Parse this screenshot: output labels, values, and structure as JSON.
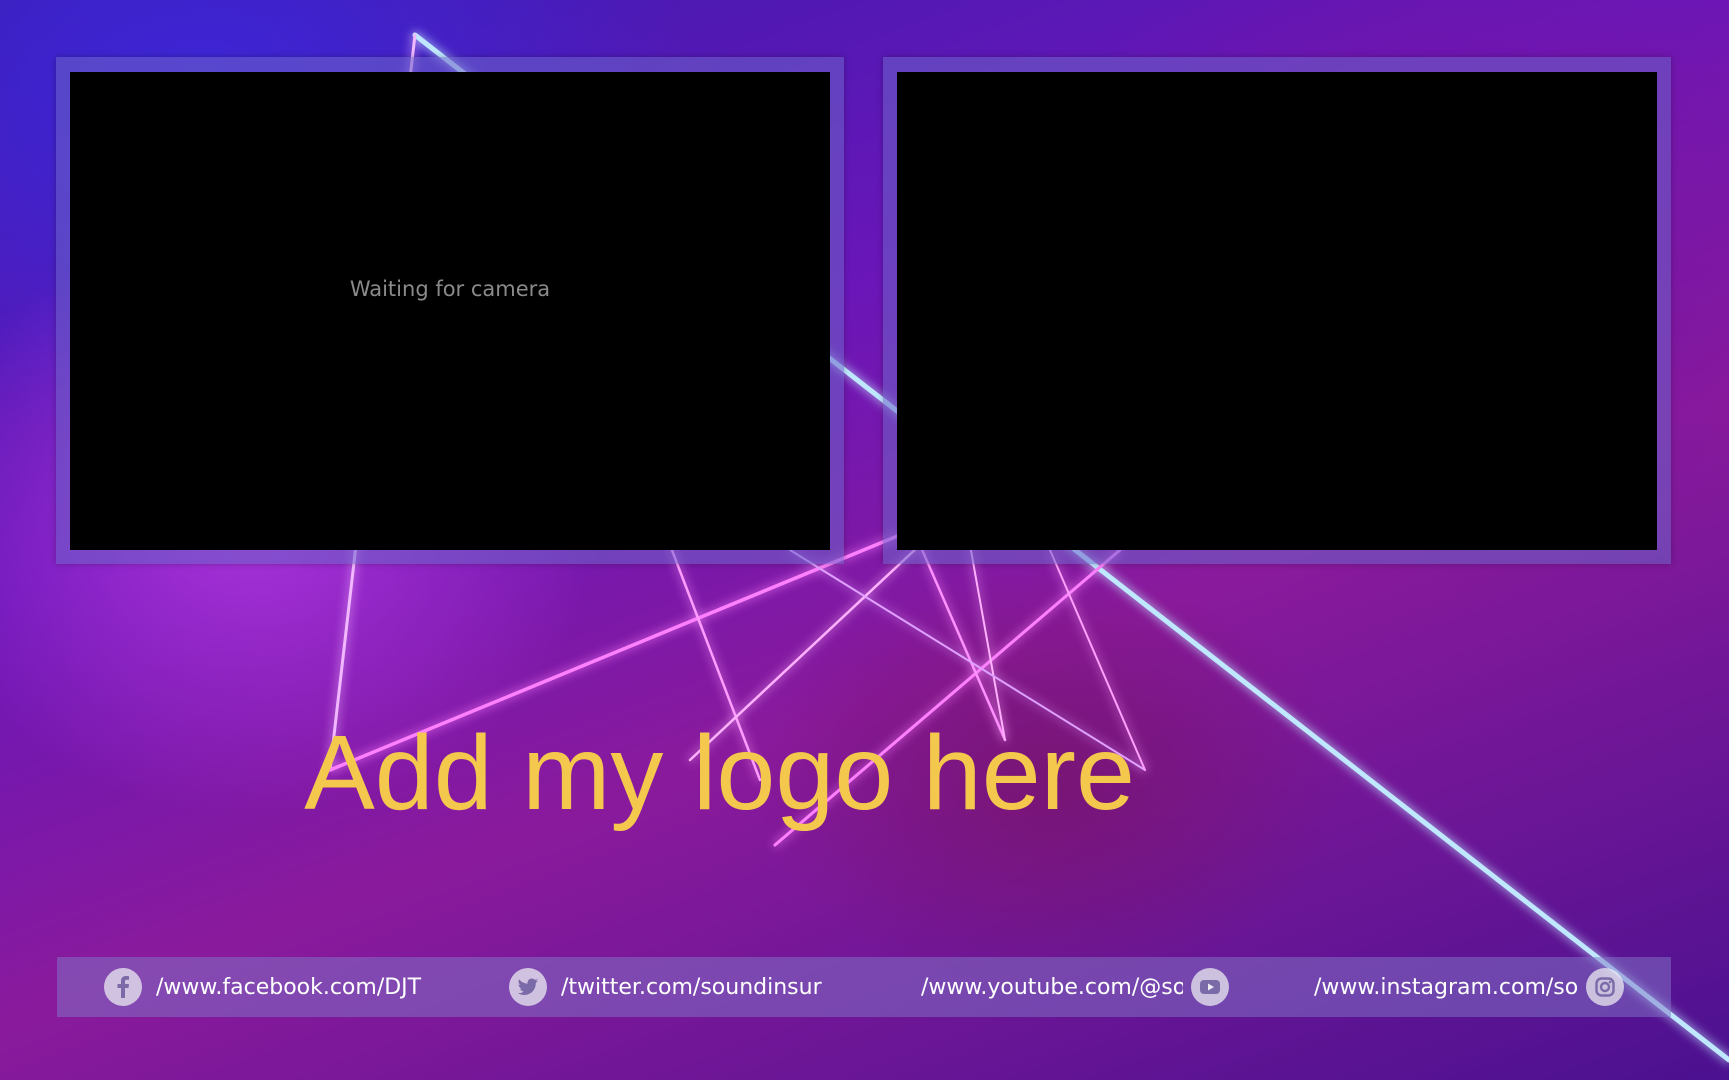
{
  "cameras": {
    "left_status": "Waiting for camera"
  },
  "logo": {
    "placeholder_text": "Add my logo here",
    "color": "#f4c84c"
  },
  "social": {
    "facebook": {
      "icon": "facebook-icon",
      "url": "/www.facebook.com/DJT"
    },
    "twitter": {
      "icon": "twitter-icon",
      "url": "/twitter.com/soundinsur"
    },
    "youtube": {
      "icon": "youtube-icon",
      "url": "/www.youtube.com/@so"
    },
    "instagram": {
      "icon": "instagram-icon",
      "url": "/www.instagram.com/so"
    }
  }
}
